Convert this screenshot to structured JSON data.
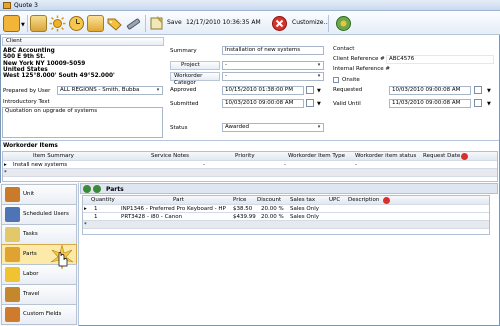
{
  "window": {
    "title": "Quote 3"
  },
  "toolbar": {
    "save_label": "Save",
    "datetime": "12/17/2010 10:36:35 AM",
    "customize_label": "Customize..."
  },
  "client": {
    "button_label": "Client",
    "name": "ABC Accounting",
    "address1": "500 E 9th St.",
    "address2": "New York NY 10009-5059",
    "country": "United States",
    "coords": "West 125°8.000'  South 49°52.000'"
  },
  "prepared": {
    "label": "Prepared by User",
    "value": "ALL REGIONS - Smith, Bubba"
  },
  "intro": {
    "label": "Introductory Text",
    "value": "Quotation on upgrade of systems"
  },
  "mid": {
    "summary_label": "Summary",
    "summary_value": "Installation of new systems",
    "project_label": "Project",
    "project_value": "-",
    "category_label": "Workorder Categor",
    "category_value": "-",
    "approved_label": "Approved",
    "approved_value": "10/15/2010 01:38:00 PM",
    "submitted_label": "Submitted",
    "submitted_value": "10/03/2010 09:00:08 AM",
    "status_label": "Status",
    "status_value": "Awarded"
  },
  "right": {
    "contact_label": "Contact",
    "client_ref_label": "Client Reference #",
    "client_ref_value": "ABC4576",
    "internal_ref_label": "Internal Reference #",
    "onsite_label": "Onsite",
    "requested_label": "Requested",
    "requested_value": "10/03/2010 09:00:08 AM",
    "valid_label": "Valid Until",
    "valid_value": "11/03/2010 09:00:08 AM"
  },
  "workorder_items": {
    "title": "Workorder Items",
    "columns": [
      "Item Summary",
      "Service Notes",
      "Priority",
      "Workorder Item Type",
      "Workorder item status",
      "Request Date"
    ],
    "rows": [
      {
        "summary": "Install new systems",
        "notes": "",
        "priority": "-",
        "type": "-",
        "status": "-",
        "date": ""
      }
    ]
  },
  "sidebar": {
    "items": [
      {
        "label": "Unit"
      },
      {
        "label": "Scheduled Users"
      },
      {
        "label": "Tasks"
      },
      {
        "label": "Parts"
      },
      {
        "label": "Labor"
      },
      {
        "label": "Travel"
      },
      {
        "label": "Custom Fields"
      }
    ]
  },
  "parts": {
    "title": "Parts",
    "columns": [
      "Quantity",
      "Part",
      "Price",
      "Discount",
      "Sales tax",
      "UPC",
      "Description"
    ],
    "rows": [
      {
        "qty": "1",
        "part": "INP1346 - Preferred Pro Keyboard - HP /",
        "price": "$38.50",
        "discount": "20.00 %",
        "tax": "Sales Only",
        "upc": "",
        "desc": ""
      },
      {
        "qty": "1",
        "part": "PRT3428 - i80 - Canon",
        "price": "$439.99",
        "discount": "20.00 %",
        "tax": "Sales Only",
        "upc": "",
        "desc": ""
      }
    ]
  }
}
